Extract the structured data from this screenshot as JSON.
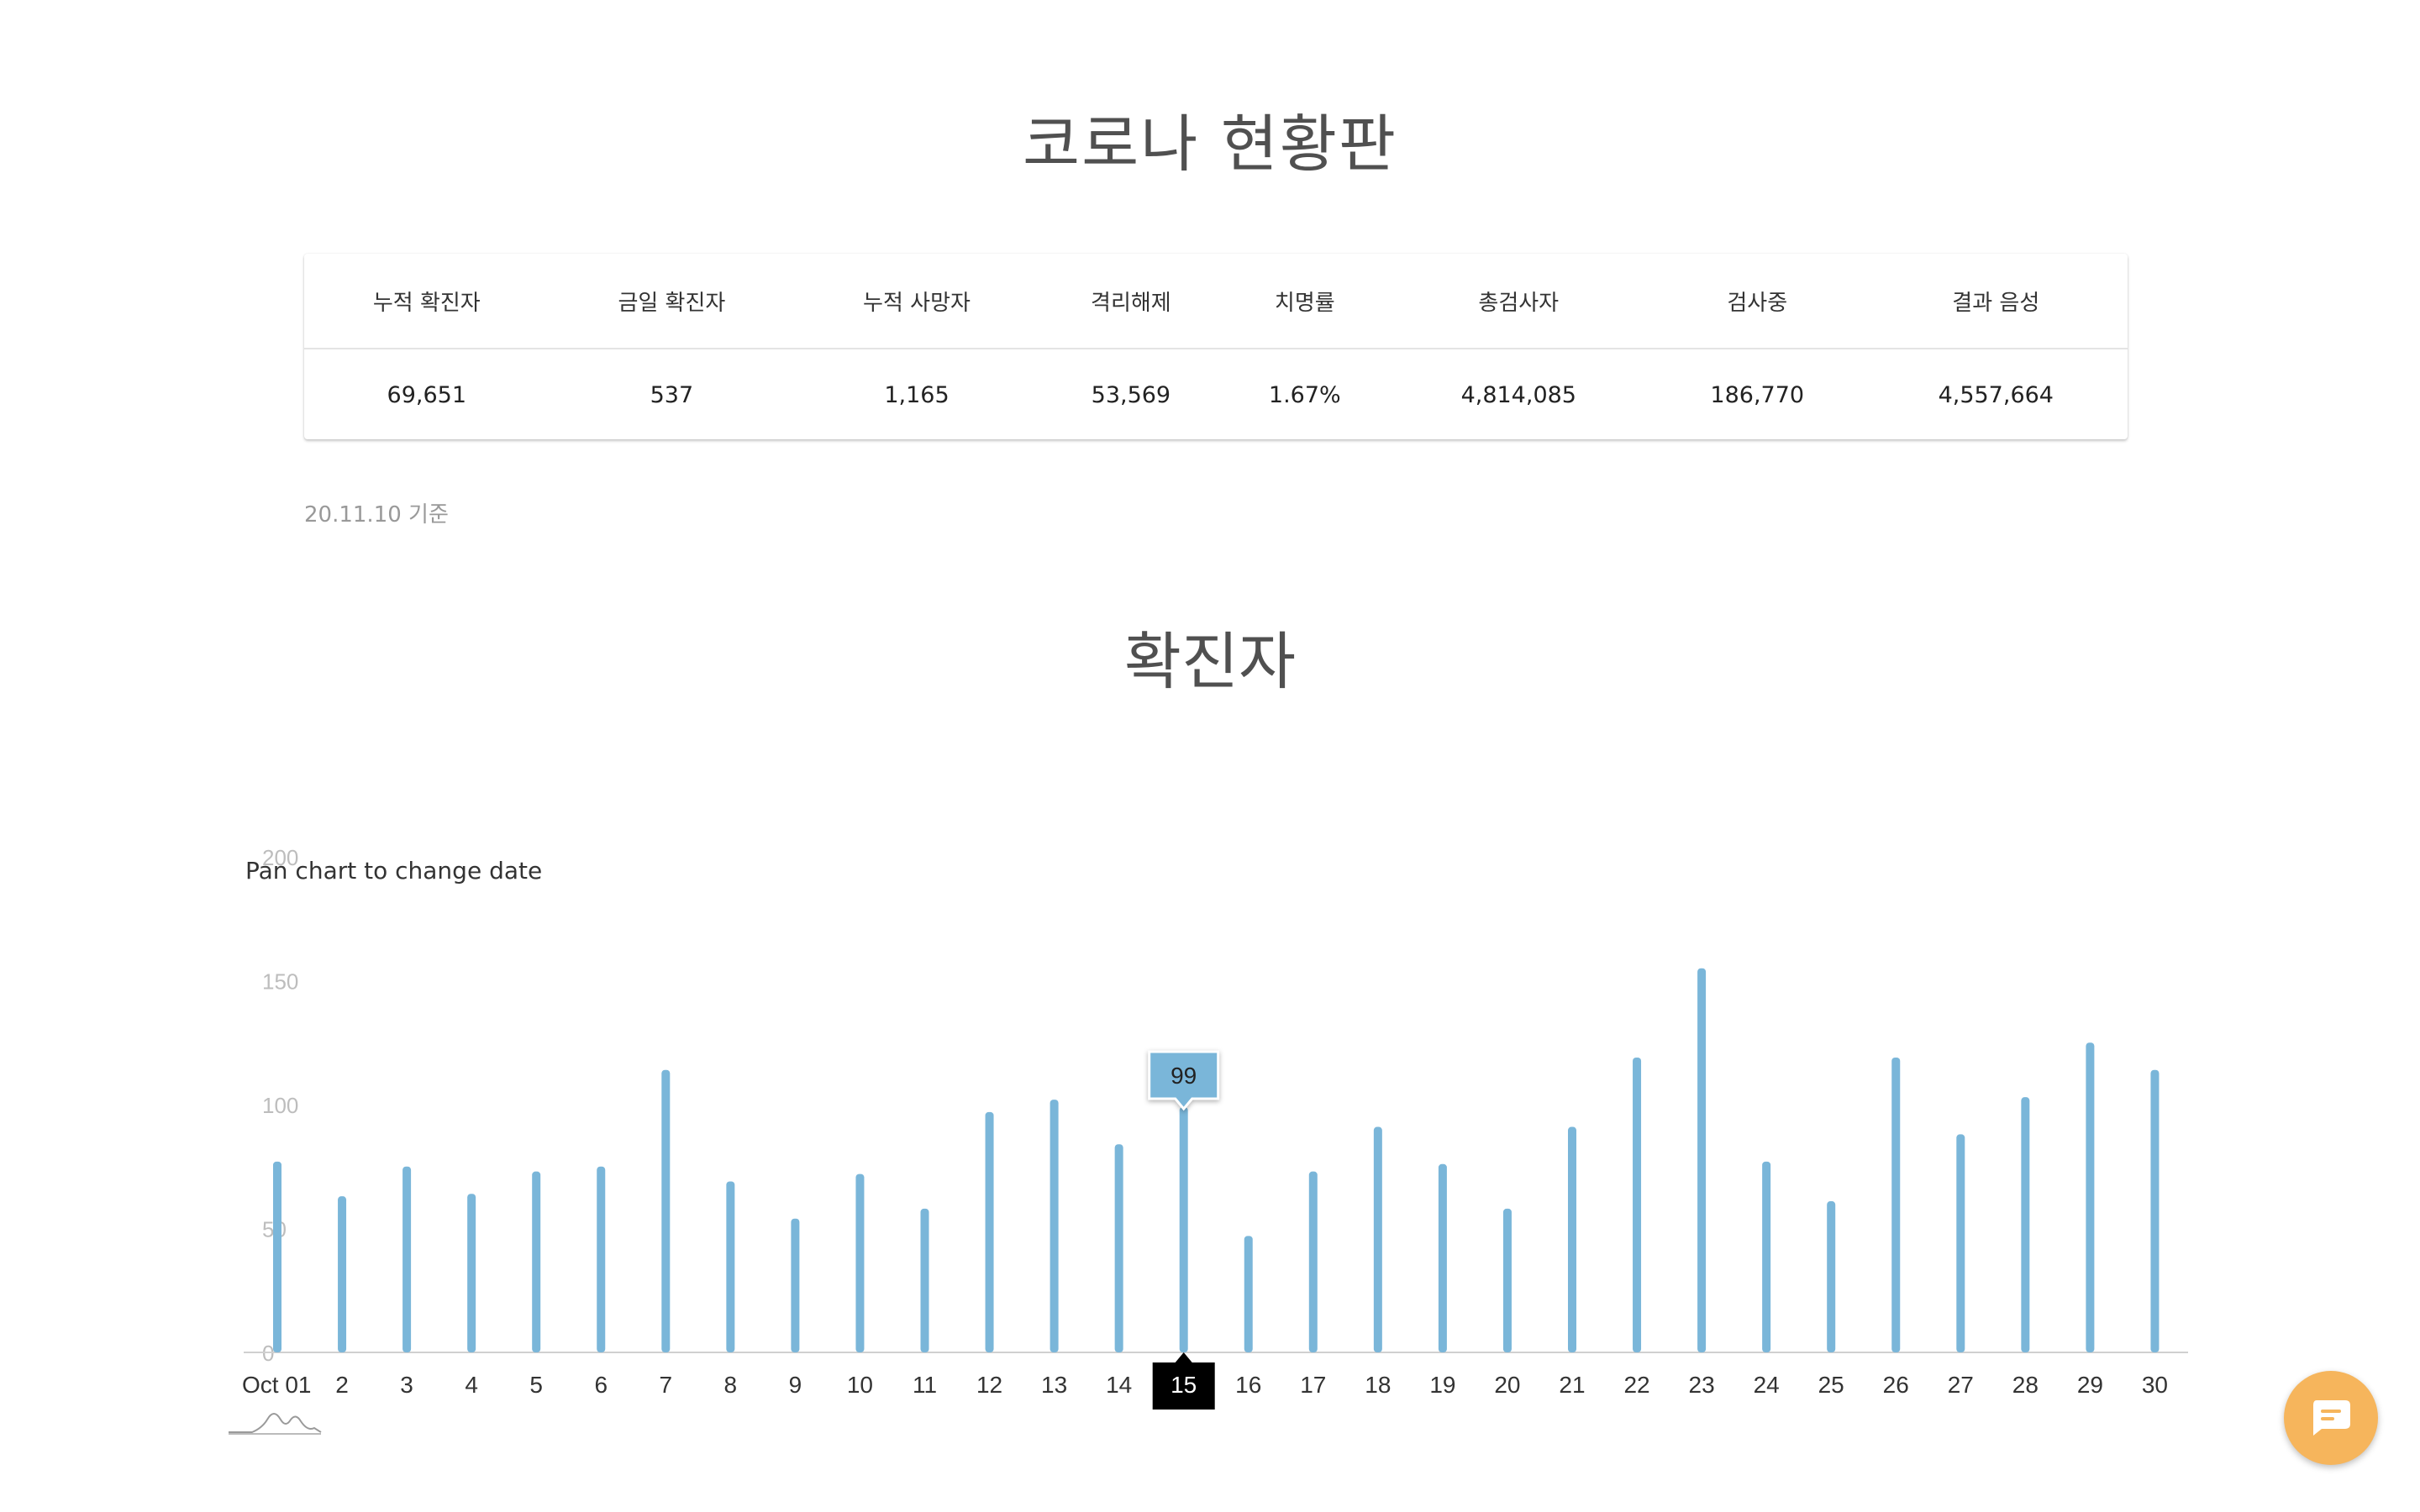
{
  "page": {
    "title": "코로나 현황판",
    "as_of_date": "20.11.10",
    "as_of_suffix": "기준",
    "chart_section_title": "확진자",
    "chart_help": "Pan chart to change date"
  },
  "stats": {
    "headers": [
      "누적 확진자",
      "금일 확진자",
      "누적 사망자",
      "격리해제",
      "치명률",
      "총검사자",
      "검사중",
      "결과 음성"
    ],
    "values": [
      "69,651",
      "537",
      "1,165",
      "53,569",
      "1.67%",
      "4,814,085",
      "186,770",
      "4,557,664"
    ]
  },
  "colors": {
    "bar": "#7ab6d9",
    "tooltip_bg": "#7ab6d9",
    "selected_label_bg": "#000000",
    "chat_button": "#f6b55c"
  },
  "icons": {
    "chat": "chat-bubble-icon",
    "navigator": "mini-navigator-sparkline"
  },
  "chart_data": {
    "type": "bar",
    "x_labels": [
      "Oct 01",
      "2",
      "3",
      "4",
      "5",
      "6",
      "7",
      "8",
      "9",
      "10",
      "11",
      "12",
      "13",
      "14",
      "15",
      "16",
      "17",
      "18",
      "19",
      "20",
      "21",
      "22",
      "23",
      "24",
      "25",
      "26",
      "27",
      "28",
      "29",
      "30"
    ],
    "values": [
      77,
      63,
      75,
      64,
      73,
      75,
      114,
      69,
      54,
      72,
      58,
      97,
      102,
      84,
      99,
      47,
      73,
      91,
      76,
      58,
      91,
      119,
      155,
      77,
      61,
      119,
      88,
      103,
      125,
      114
    ],
    "y_ticks": [
      0,
      50,
      100,
      150,
      200
    ],
    "ylim": [
      0,
      200
    ],
    "selected_index": 14,
    "tooltip_value": "99",
    "grid": false
  }
}
